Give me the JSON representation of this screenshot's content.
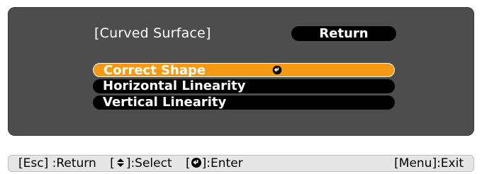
{
  "menu": {
    "title": "[Curved Surface]",
    "return_label": "Return",
    "items": [
      {
        "label": "Correct Shape",
        "selected": true,
        "icon": "enter-icon"
      },
      {
        "label": "Horizontal Linearity",
        "selected": false
      },
      {
        "label": "Vertical Linearity",
        "selected": false
      }
    ]
  },
  "help": {
    "esc_label": "[Esc] :Return",
    "select_prefix": "[",
    "select_suffix": "]:Select",
    "enter_prefix": "[",
    "enter_suffix": "]:Enter",
    "menu_label": "[Menu]:Exit"
  },
  "colors": {
    "panel": "#4d4d4d",
    "button": "#000000",
    "selected": "#f59a14",
    "text": "#ffffff"
  }
}
